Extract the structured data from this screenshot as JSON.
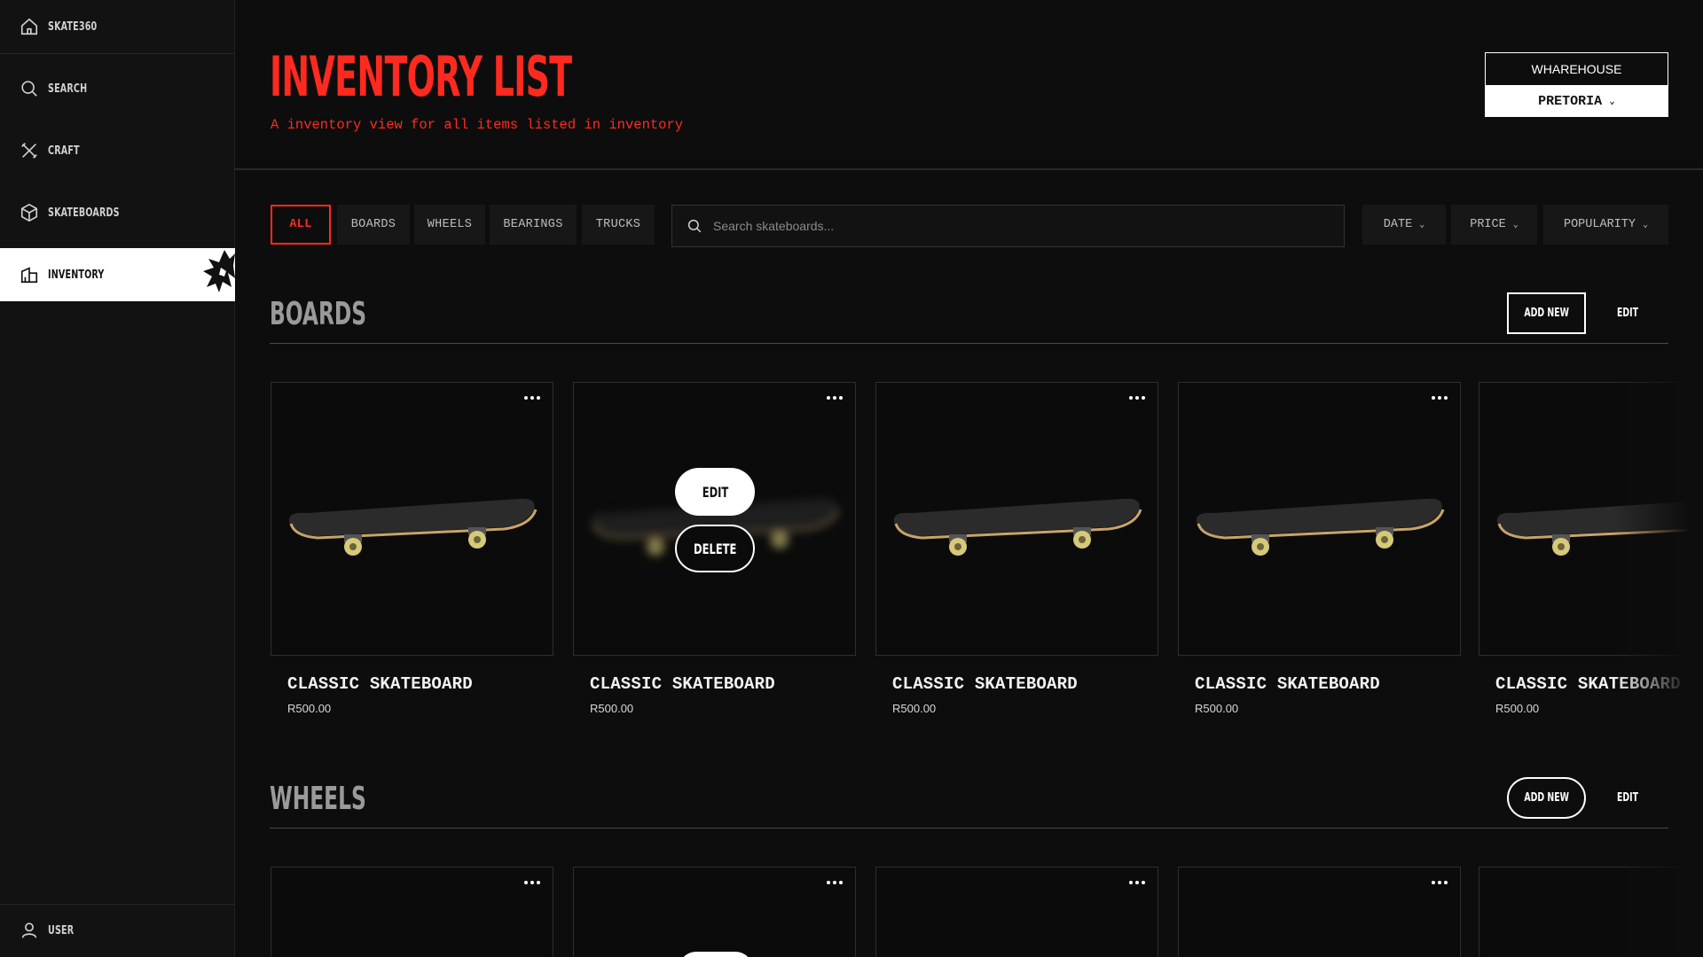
{
  "sidebar": {
    "items": [
      {
        "label": "SKATE360",
        "icon": "home-icon"
      },
      {
        "label": "SEARCH",
        "icon": "search-icon"
      },
      {
        "label": "CRAFT",
        "icon": "tools-icon"
      },
      {
        "label": "SKATEBOARDS",
        "icon": "box-icon"
      },
      {
        "label": "INVENTORY",
        "icon": "warehouse-icon",
        "active": true
      }
    ],
    "user": {
      "label": "USER",
      "icon": "user-icon"
    }
  },
  "header": {
    "title": "INVENTORY LIST",
    "subtitle": "A inventory view for all items listed in inventory",
    "warehouse_label": "WHAREHOUSE",
    "warehouse_value": "PRETORIA"
  },
  "filters": {
    "tabs": [
      "ALL",
      "BOARDS",
      "WHEELS",
      "BEARINGS",
      "TRUCKS"
    ],
    "active_tab": "ALL",
    "search_placeholder": "Search skateboards...",
    "sort": [
      "DATE",
      "PRICE",
      "POPULARITY"
    ]
  },
  "sections": [
    {
      "title": "BOARDS",
      "add_label": "ADD NEW",
      "edit_label": "EDIT",
      "items": [
        {
          "name": "CLASSIC SKATEBOARD",
          "price": "R500.00"
        },
        {
          "name": "CLASSIC SKATEBOARD",
          "price": "R500.00",
          "hover": true,
          "edit_label": "EDIT",
          "delete_label": "DELETE"
        },
        {
          "name": "CLASSIC SKATEBOARD",
          "price": "R500.00"
        },
        {
          "name": "CLASSIC SKATEBOARD",
          "price": "R500.00"
        },
        {
          "name": "CLASSIC SKATEBOARD",
          "price": "R500.00"
        }
      ]
    },
    {
      "title": "WHEELS",
      "add_label": "ADD NEW",
      "edit_label": "EDIT"
    }
  ],
  "colors": {
    "accent": "#ff2a1f",
    "background": "#0d0d0d",
    "sidebar": "#121212"
  }
}
